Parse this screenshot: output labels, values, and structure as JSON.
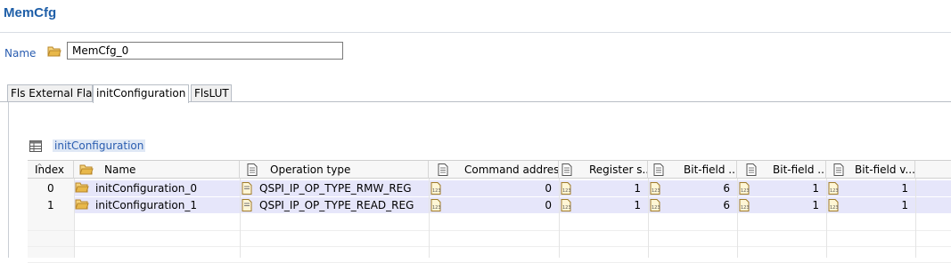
{
  "header": {
    "title": "MemCfg"
  },
  "name_field": {
    "label": "Name",
    "value": "MemCfg_0"
  },
  "tabs": [
    {
      "label": "Fls External Flash",
      "active": false
    },
    {
      "label": "initConfiguration",
      "active": true
    },
    {
      "label": "FlsLUT",
      "active": false
    }
  ],
  "section": {
    "title": "initConfiguration"
  },
  "table": {
    "columns": [
      "Index",
      "Name",
      "Operation type",
      "Command address",
      "Register s...",
      "Bit-field ...",
      "Bit-field ...",
      "Bit-field v..."
    ],
    "rows": [
      {
        "index": "0",
        "name": "initConfiguration_0",
        "op_type": "QSPI_IP_OP_TYPE_RMW_REG",
        "cmd_addr": "0",
        "reg_size": "1",
        "bf1": "6",
        "bf2": "1",
        "bf3": "1"
      },
      {
        "index": "1",
        "name": "initConfiguration_1",
        "op_type": "QSPI_IP_OP_TYPE_READ_REG",
        "cmd_addr": "0",
        "reg_size": "1",
        "bf1": "6",
        "bf2": "1",
        "bf3": "1"
      }
    ]
  },
  "colors": {
    "title": "#1f5fa8",
    "label": "#2a5db0",
    "selection": "#e6e6fa",
    "folder": "#e8b84a"
  }
}
